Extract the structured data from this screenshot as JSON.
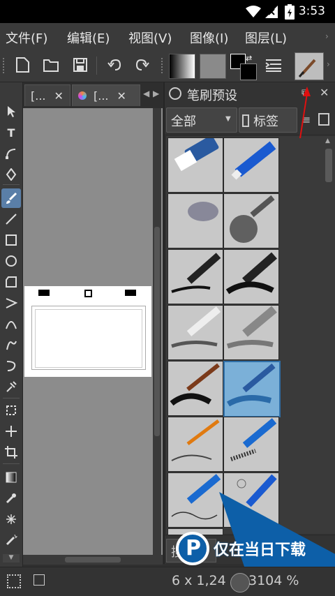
{
  "status_bar": {
    "time": "3:53"
  },
  "menubar": {
    "items": [
      "文件(F)",
      "编辑(E)",
      "视图(V)",
      "图像(I)",
      "图层(L)"
    ]
  },
  "tabs": [
    {
      "label": "[..."
    },
    {
      "label": "[..."
    }
  ],
  "docker": {
    "title": "笔刷预设",
    "filter_value": "全部",
    "tag_label": "标签"
  },
  "search": {
    "placeholder": "搜"
  },
  "status": {
    "size_readout": "6 x 1,24",
    "zoom_readout": "3104 %"
  },
  "watermark": {
    "text": "仅在当日下载"
  },
  "colors": {
    "accent": "#5a7fa8",
    "selected_cell": "#7bb0d8",
    "watermark_blue": "#0d5fa8"
  }
}
